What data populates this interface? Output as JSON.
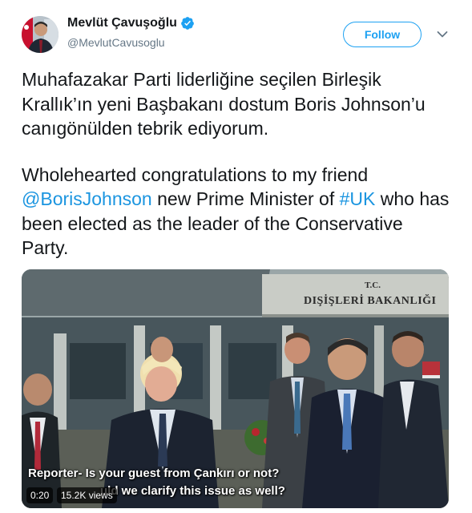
{
  "author": {
    "display_name": "Mevlüt Çavuşoğlu",
    "handle": "@MevlutCavusoglu",
    "verified": true
  },
  "actions": {
    "follow_label": "Follow"
  },
  "tweet": {
    "turkish_text": "Muhafazakar Parti liderliğine seçilen Birleşik Krallık’ın yeni Başbakanı dostum Boris Johnson’u canıgönülden tebrik ediyorum.",
    "english_before": "Wholehearted congratulations to my friend ",
    "mention": "@BorisJohnson",
    "english_middle": " new Prime Minister of ",
    "hashtag": "#UK",
    "english_after": " who has been elected as the leader of the Conservative Party."
  },
  "video": {
    "sign_small": "T.C.",
    "sign_text": "DIŞİŞLERİ BAKANLIĞI",
    "subtitle_line1": "Reporter-  Is your guest from Çankırı or not?",
    "subtitle_line2": "uld we clarify this issue as well?",
    "duration": "0:20",
    "views": "15.2K views"
  },
  "colors": {
    "link": "#1b95e0",
    "follow": "#1da1f2",
    "text": "#14171a",
    "muted": "#657786"
  },
  "icons": {
    "verified": "verified-badge-icon",
    "chevron": "chevron-down-icon"
  }
}
